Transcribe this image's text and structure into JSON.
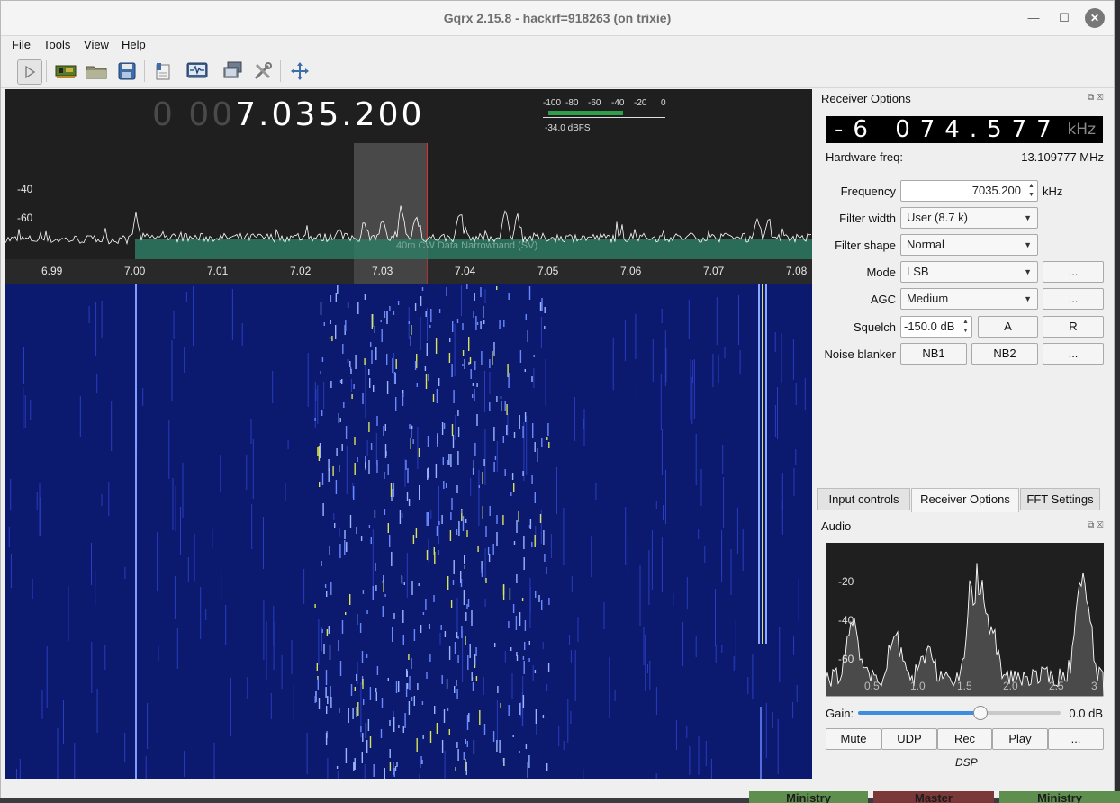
{
  "window": {
    "title": "Gqrx 2.15.8 - hackrf=918263 (on trixie)",
    "minimize": "—",
    "maximize": "☐",
    "close": "✕"
  },
  "menu": {
    "items": [
      {
        "label": "File",
        "u": "F",
        "rest": "ile"
      },
      {
        "label": "Tools",
        "u": "T",
        "rest": "ools"
      },
      {
        "label": "View",
        "u": "V",
        "rest": "iew"
      },
      {
        "label": "Help",
        "u": "H",
        "rest": "elp"
      }
    ]
  },
  "toolbar": {
    "icons": [
      "play-icon",
      "hardware-card-icon",
      "open-folder-icon",
      "save-icon",
      "bookmark-icon",
      "remote-control-icon",
      "network-icon",
      "settings-tools-icon",
      "fullscreen-icon"
    ]
  },
  "spectrum": {
    "freq_dim": "0 00",
    "freq_main": "7.035.200",
    "meter_ticks": [
      "-100",
      "-80",
      "-60",
      "-40",
      "-20",
      "0"
    ],
    "meter_level_dbfs": -34.0,
    "meter_label": "-34.0 dBFS",
    "y_ticks": [
      "-40",
      "-60"
    ],
    "x_ticks": [
      "6.99",
      "7.00",
      "7.01",
      "7.02",
      "7.03",
      "7.04",
      "7.05",
      "7.06",
      "7.07",
      "7.08"
    ],
    "band_label": "40m CW Data Narrowband (SV)",
    "colors": {
      "background": "#1f1f1f",
      "trace": "#ffffff",
      "band": "#2d7a63",
      "marker": "#e03030",
      "waterfall": "#0b1a6e"
    }
  },
  "receiver": {
    "title": "Receiver Options",
    "lcd_digits": "-6 074.577",
    "lcd_unit": "kHz",
    "hw_freq_label": "Hardware freq:",
    "hw_freq_value": "13.109777 MHz",
    "frequency_label": "Frequency",
    "frequency_value": "7035.200",
    "frequency_unit": "kHz",
    "filter_width_label": "Filter width",
    "filter_width_value": "User (8.7 k)",
    "filter_shape_label": "Filter shape",
    "filter_shape_value": "Normal",
    "mode_label": "Mode",
    "mode_value": "LSB",
    "agc_label": "AGC",
    "agc_value": "Medium",
    "squelch_label": "Squelch",
    "squelch_value": "-150.0 dB",
    "squelch_a": "A",
    "squelch_r": "R",
    "nb_label": "Noise blanker",
    "nb1": "NB1",
    "nb2": "NB2",
    "more": "..."
  },
  "tabs": [
    {
      "label": "Input controls",
      "active": false
    },
    {
      "label": "Receiver Options",
      "active": true
    },
    {
      "label": "FFT Settings",
      "active": false
    }
  ],
  "audio": {
    "title": "Audio",
    "y_ticks": [
      "-20",
      "-40",
      "-60"
    ],
    "x_ticks": [
      "0.5",
      "1.0",
      "1.5",
      "2.0",
      "2.5",
      "3"
    ],
    "gain_label": "Gain:",
    "gain_value": "0.0 dB",
    "gain_fraction": 0.6,
    "buttons": [
      "Mute",
      "UDP",
      "Rec",
      "Play",
      "..."
    ],
    "dsp_label": "DSP"
  },
  "background": {
    "tabs": [
      "Ministry",
      "Master",
      "Ministry"
    ]
  }
}
